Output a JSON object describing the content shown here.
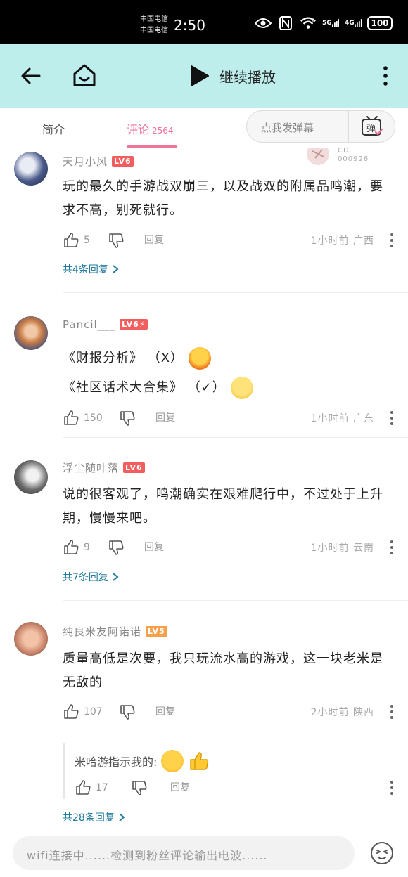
{
  "status": {
    "carrier1": "中国电信",
    "carrier2": "中国电信",
    "time": "2:50",
    "signal1": "6",
    "net1": "5G",
    "net2": "4G",
    "battery": "100"
  },
  "header": {
    "play_label": "继续播放"
  },
  "tabs": {
    "intro": "简介",
    "comments": "评论",
    "comments_count": "2564"
  },
  "danmu": {
    "placeholder": "点我发弹幕",
    "button": "弹"
  },
  "overlay": {
    "code_line1": "CD.",
    "code_line2": "000926"
  },
  "comments": [
    {
      "user": "天月小风",
      "level": "LV6",
      "text": "玩的最久的手游战双崩三，以及战双的附属品鸣潮，要求不高，别死就行。",
      "likes": "5",
      "reply_label": "回复",
      "meta": "1小时前  广西",
      "replies": "共4条回复"
    },
    {
      "user": "Pancil___",
      "level": "LV6⚡",
      "line1": "《财报分析》  （X）",
      "line2": "《社区话术大合集》  （✓）",
      "likes": "150",
      "reply_label": "回复",
      "meta": "1小时前  广东"
    },
    {
      "user": "浮尘随叶落",
      "level": "LV6",
      "text": "说的很客观了，鸣潮确实在艰难爬行中，不过处于上升期，慢慢来吧。",
      "likes": "9",
      "reply_label": "回复",
      "meta": "1小时前  云南",
      "replies": "共7条回复"
    },
    {
      "user": "纯良米友阿诺诺",
      "level": "LV5",
      "text": "质量高低是次要，我只玩流水高的游戏，这一块老米是无敌的",
      "likes": "107",
      "reply_label": "回复",
      "meta": "2小时前  陕西",
      "sub_text": "米哈游指示我的:",
      "sub_likes": "17",
      "sub_reply_label": "回复",
      "replies": "共28条回复"
    }
  ],
  "bottom": {
    "input_placeholder": "wifi连接中......检测到粉丝评论输出电波......"
  },
  "colors": {
    "header_bg": "#bdeeec",
    "accent_pink": "#f0739a",
    "link_blue": "#227b9f",
    "level_red": "#f25d5d",
    "level_orange": "#f5a04a"
  }
}
